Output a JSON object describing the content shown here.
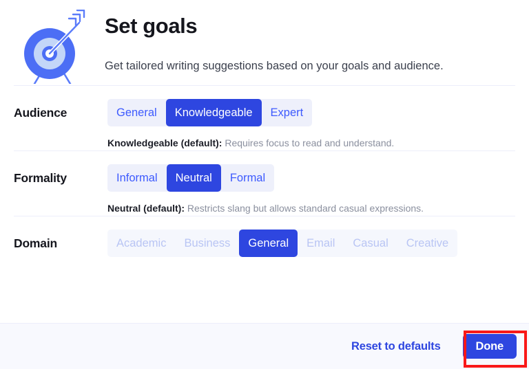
{
  "header": {
    "icon": "target-with-arrow-icon",
    "title": "Set goals",
    "subtitle": "Get tailored writing suggestions based on your goals and audience."
  },
  "settings": [
    {
      "key": "audience",
      "label": "Audience",
      "options": [
        "General",
        "Knowledgeable",
        "Expert"
      ],
      "selected": "Knowledgeable",
      "faded": false,
      "description_label": "Knowledgeable (default):",
      "description_text": "Requires focus to read and understand."
    },
    {
      "key": "formality",
      "label": "Formality",
      "options": [
        "Informal",
        "Neutral",
        "Formal"
      ],
      "selected": "Neutral",
      "faded": false,
      "description_label": "Neutral (default):",
      "description_text": "Restricts slang but allows standard casual expressions."
    },
    {
      "key": "domain",
      "label": "Domain",
      "options": [
        "Academic",
        "Business",
        "General",
        "Email",
        "Casual",
        "Creative"
      ],
      "selected": "General",
      "faded": true,
      "description_label": "",
      "description_text": ""
    }
  ],
  "footer": {
    "reset_label": "Reset to defaults",
    "done_label": "Done"
  },
  "annotation": {
    "target": "done-button",
    "color": "#f91818"
  },
  "colors": {
    "accent": "#2e46e0",
    "accent_text": "#3d5afe",
    "pill_background": "#eef0fb",
    "pill_background_faded": "#f5f7fd",
    "footer_background": "#f8f9fe",
    "divider": "#eceefa",
    "title": "#15161d",
    "subtitle": "#3a3f4c",
    "description": "#8a8f9e",
    "highlight": "#f91818"
  }
}
